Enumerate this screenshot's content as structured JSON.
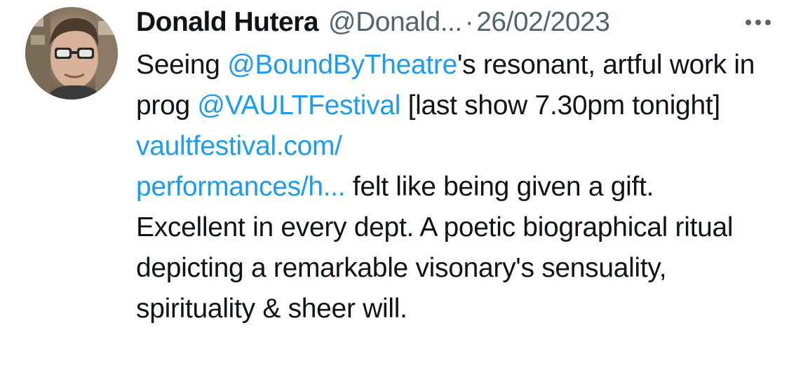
{
  "tweet": {
    "author": {
      "display_name": "Donald Hutera",
      "handle": "@Donald...",
      "avatar": "profile-photo"
    },
    "separator": "·",
    "date": "26/02/2023",
    "more_icon": "more-horizontal-icon",
    "body": {
      "t1": "Seeing ",
      "mention1": "@BoundByTheatre",
      "t2": "'s resonant, artful work in prog ",
      "mention2": "@VAULTFestival",
      "t3": " [last show 7.30pm tonight] ",
      "url_part1": "vaultfestival.com/",
      "url_part2": "performances/h...",
      "t4": " felt like being given a gift. Excellent in every dept. A poetic biographical ritual depicting a remarkable visonary's sensuality, spirituality & sheer will."
    },
    "colors": {
      "text": "#0f1419",
      "secondary": "#536471",
      "link": "#1d9bf0"
    }
  }
}
